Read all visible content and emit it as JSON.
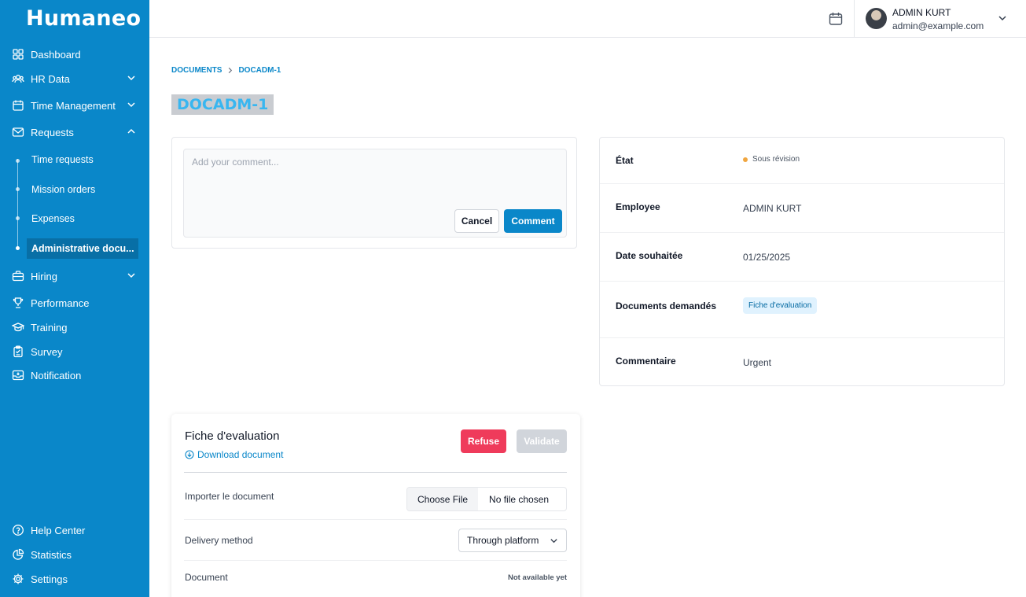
{
  "brand": "Humaneo",
  "colors": {
    "primary": "#0a87c9",
    "refuse": "#ef3b5b",
    "status_warning": "#f0a640"
  },
  "sidebar": {
    "items": [
      {
        "label": "Dashboard",
        "icon": "grid-icon"
      },
      {
        "label": "HR Data",
        "icon": "users-icon"
      },
      {
        "label": "Time Management",
        "icon": "calendar-icon"
      },
      {
        "label": "Requests",
        "icon": "envelope-icon"
      },
      {
        "label": "Hiring",
        "icon": "briefcase-icon"
      },
      {
        "label": "Performance",
        "icon": "trophy-icon"
      },
      {
        "label": "Training",
        "icon": "graduation-cap-icon"
      },
      {
        "label": "Survey",
        "icon": "clipboard-icon"
      },
      {
        "label": "Notification",
        "icon": "inbox-icon"
      }
    ],
    "requests_sub": [
      "Time requests",
      "Mission orders",
      "Expenses",
      "Administrative docu..."
    ],
    "bottom": [
      {
        "label": "Help Center",
        "icon": "help-circle-icon"
      },
      {
        "label": "Statistics",
        "icon": "pie-chart-icon"
      },
      {
        "label": "Settings",
        "icon": "gear-icon"
      }
    ]
  },
  "header": {
    "user_name": "ADMIN KURT",
    "user_email": "admin@example.com"
  },
  "breadcrumb": {
    "root": "DOCUMENTS",
    "current": "DOCADM-1"
  },
  "page_title": "DOCADM-1",
  "comment": {
    "placeholder": "Add your comment...",
    "cancel": "Cancel",
    "submit": "Comment"
  },
  "details": {
    "etat_label": "État",
    "etat_value": "Sous révision",
    "employee_label": "Employee",
    "employee_value": "ADMIN KURT",
    "date_label": "Date souhaitée",
    "date_value": "01/25/2025",
    "docs_label": "Documents demandés",
    "docs_value": "Fiche d'evaluation",
    "comment_label": "Commentaire",
    "comment_value": "Urgent"
  },
  "document": {
    "title": "Fiche d'evaluation",
    "download": "Download document",
    "refuse": "Refuse",
    "validate": "Validate",
    "import_label": "Importer le document",
    "choose_file": "Choose File",
    "no_file": "No file chosen",
    "delivery_label": "Delivery method",
    "delivery_value": "Through platform",
    "document_label": "Document",
    "document_status": "Not available yet"
  }
}
